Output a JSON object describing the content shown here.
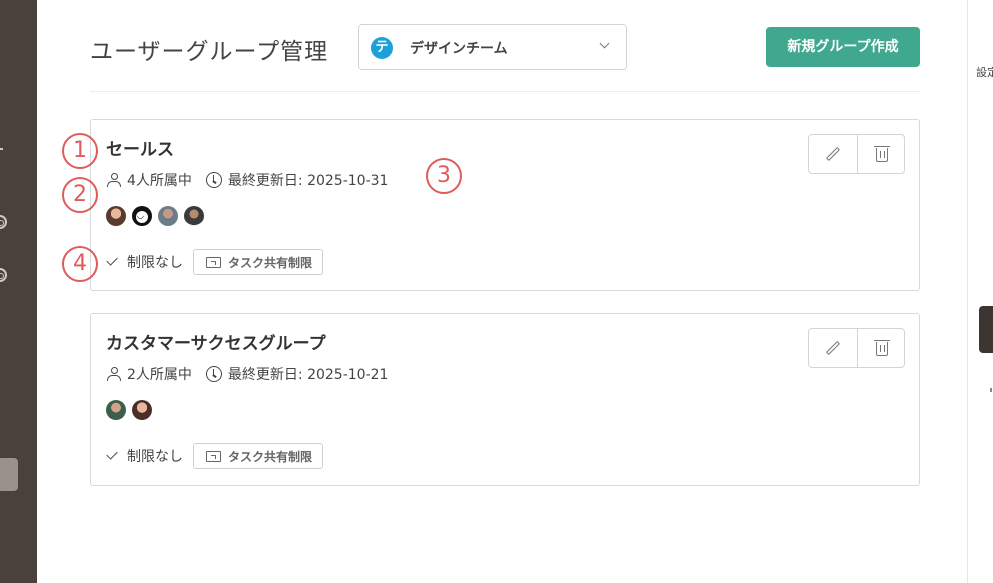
{
  "page": {
    "title": "ユーザーグループ管理",
    "create_button_label": "新規グループ作成"
  },
  "team_selector": {
    "logo_letter": "テ",
    "value": "デザインチーム",
    "icon": "chevron-down-icon"
  },
  "right_panel": {
    "label": "設定"
  },
  "groups": [
    {
      "name": "セールス",
      "members_text": "4人所属中",
      "updated_text": "最終更新日: 2025-10-31",
      "restriction_label": "制限なし",
      "share_badge_label": "タスク共有制限"
    },
    {
      "name": "カスタマーサクセスグループ",
      "members_text": "2人所属中",
      "updated_text": "最終更新日: 2025-10-21",
      "restriction_label": "制限なし",
      "share_badge_label": "タスク共有制限"
    }
  ],
  "annotation_markers": [
    "1",
    "2",
    "3",
    "4"
  ],
  "colors": {
    "accent": "#3fa88e",
    "team_logo": "#1ea0d8",
    "marker": "#e15b5b",
    "sidebar": "#4a403c"
  }
}
